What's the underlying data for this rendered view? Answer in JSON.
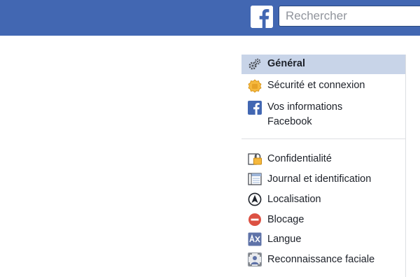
{
  "header": {
    "logo_icon": "facebook-f-icon",
    "search_placeholder": "Rechercher",
    "bar_color": "#4267b2"
  },
  "settings_nav": {
    "group1": [
      {
        "label": "Général",
        "icon": "gears-icon",
        "active": true
      },
      {
        "label": "Sécurité et connexion",
        "icon": "shield-badge-icon",
        "active": false
      },
      {
        "label": "Vos informations",
        "label2": "Facebook",
        "icon": "facebook-square-icon",
        "active": false
      }
    ],
    "group2": [
      {
        "label": "Confidentialité",
        "icon": "padlock-icon"
      },
      {
        "label": "Journal et identification",
        "icon": "timeline-icon"
      },
      {
        "label": "Localisation",
        "icon": "location-compass-icon"
      },
      {
        "label": "Blocage",
        "icon": "block-icon"
      },
      {
        "label": "Langue",
        "icon": "language-icon"
      },
      {
        "label": "Reconnaissance faciale",
        "icon": "face-recognition-icon"
      }
    ]
  }
}
